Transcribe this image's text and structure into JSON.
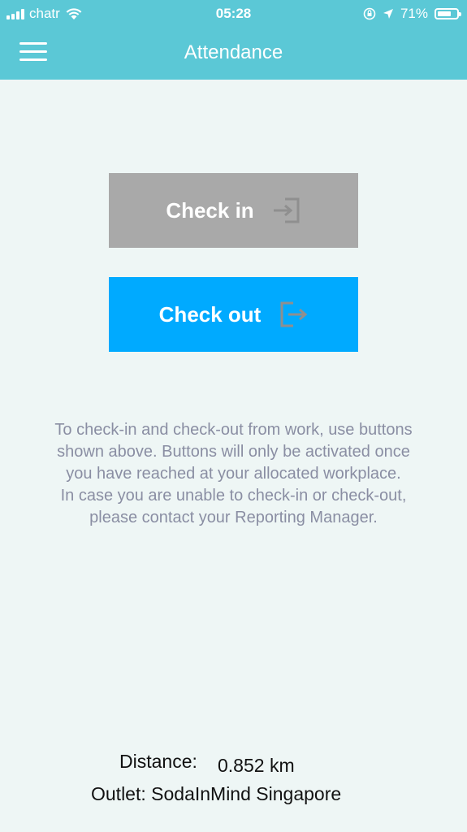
{
  "status_bar": {
    "carrier": "chatr",
    "time": "05:28",
    "battery_percent": "71%",
    "battery_level": 0.71,
    "icons": [
      "signal-icon",
      "wifi-icon",
      "orientation-lock-icon",
      "location-icon",
      "battery-icon"
    ]
  },
  "header": {
    "title": "Attendance",
    "menu_icon": "hamburger-menu-icon",
    "background_color": "#5bc8d6"
  },
  "buttons": {
    "check_in": {
      "label": "Check in",
      "icon": "login-icon",
      "color": "#a9a9a9",
      "enabled": false
    },
    "check_out": {
      "label": "Check out",
      "icon": "logout-icon",
      "color": "#00aaff",
      "enabled": true
    }
  },
  "info": {
    "paragraph1": "To check-in and check-out from work, use buttons shown above. Buttons will only be activated once you have reached at your allocated workplace.",
    "paragraph2": "In case you are unable to check-in or check-out, please contact your Reporting Manager."
  },
  "footer": {
    "distance_label": "Distance:",
    "distance_value": "0.852 km",
    "outlet_text": "Outlet: SodaInMind Singapore"
  }
}
